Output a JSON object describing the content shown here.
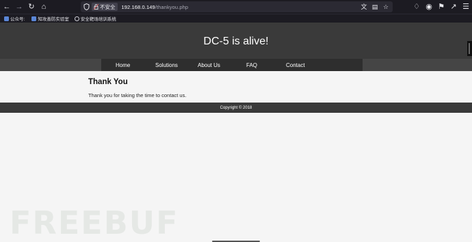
{
  "browser": {
    "url_security_label": "不安全",
    "url_host": "192.168.0.149",
    "url_path": "/thankyou.php",
    "bookmarks": [
      {
        "label": "公众号:",
        "icon": "wechat-icon"
      },
      {
        "label": "知攻善防实验室",
        "icon": "lab-icon"
      },
      {
        "label": "安全靶场培训系统",
        "icon": "globe-icon"
      }
    ]
  },
  "site": {
    "title": "DC-5 is alive!",
    "menu": [
      "Home",
      "Solutions",
      "About Us",
      "FAQ",
      "Contact"
    ]
  },
  "content": {
    "heading": "Thank You",
    "message": "Thank you for taking the time to contact us."
  },
  "footer": {
    "copyright": "Copyright © 2018"
  },
  "watermark": {
    "text": "FREEBUF"
  },
  "colors": {
    "header_bg": "#3a3a3a",
    "menu_bg": "#2e2e2e",
    "browser_bg": "#1c1b22"
  }
}
